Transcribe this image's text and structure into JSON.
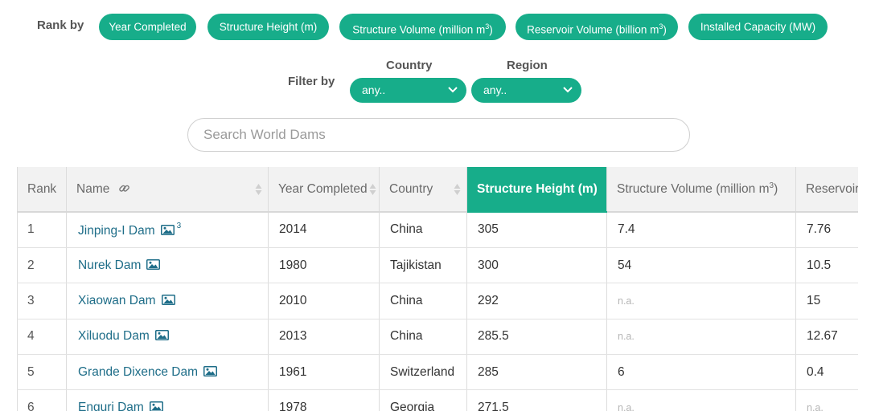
{
  "rank_by": {
    "label": "Rank by",
    "options": [
      {
        "label": "Year Completed",
        "sup": ""
      },
      {
        "label": "Structure Height (m)",
        "sup": ""
      },
      {
        "label": "Structure Volume (million m",
        "sup": "3",
        "suffix": ")"
      },
      {
        "label": "Reservoir Volume (billion m",
        "sup": "3",
        "suffix": ")"
      },
      {
        "label": "Installed Capacity (MW)",
        "sup": ""
      }
    ]
  },
  "filter": {
    "label": "Filter by",
    "country": {
      "label": "Country",
      "value": "any.."
    },
    "region": {
      "label": "Region",
      "value": "any.."
    }
  },
  "search": {
    "placeholder": "Search World Dams",
    "value": ""
  },
  "accent_color": "#17ad8a",
  "table": {
    "columns": {
      "rank": "Rank",
      "name": "Name",
      "year": "Year Completed",
      "country": "Country",
      "height": "Structure Height (m)",
      "volume": "Structure Volume (million m",
      "volume_sup": "3",
      "volume_suffix": ")",
      "reservoir": "Reservoir Volume (billion m"
    },
    "active_column": "height",
    "rows": [
      {
        "rank": "1",
        "name": "Jinping-I Dam",
        "img_count": "3",
        "year": "2014",
        "country": "China",
        "height": "305",
        "volume": "7.4",
        "reservoir": "7.76"
      },
      {
        "rank": "2",
        "name": "Nurek Dam",
        "img_count": "",
        "year": "1980",
        "country": "Tajikistan",
        "height": "300",
        "volume": "54",
        "reservoir": "10.5"
      },
      {
        "rank": "3",
        "name": "Xiaowan Dam",
        "img_count": "",
        "year": "2010",
        "country": "China",
        "height": "292",
        "volume": "n.a.",
        "reservoir": "15"
      },
      {
        "rank": "4",
        "name": "Xiluodu Dam",
        "img_count": "",
        "year": "2013",
        "country": "China",
        "height": "285.5",
        "volume": "n.a.",
        "reservoir": "12.67"
      },
      {
        "rank": "5",
        "name": "Grande Dixence Dam",
        "img_count": "",
        "year": "1961",
        "country": "Switzerland",
        "height": "285",
        "volume": "6",
        "reservoir": "0.4"
      },
      {
        "rank": "6",
        "name": "Enguri Dam",
        "img_count": "",
        "year": "1978",
        "country": "Georgia",
        "height": "271.5",
        "volume": "n.a.",
        "reservoir": "n.a."
      }
    ]
  }
}
